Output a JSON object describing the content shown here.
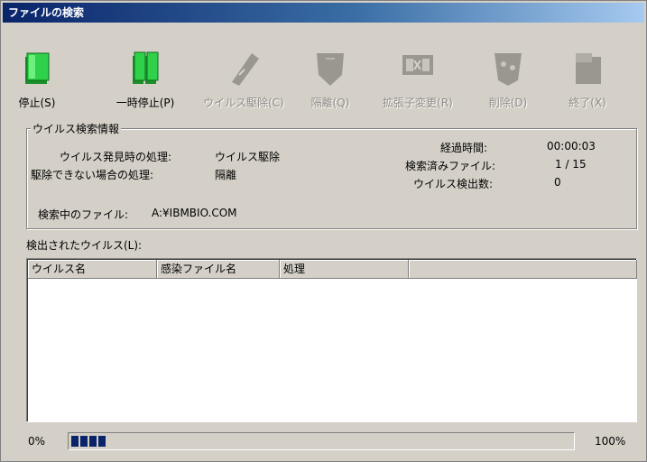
{
  "window": {
    "title": "ファイルの検索"
  },
  "toolbar": {
    "buttons": [
      {
        "label": "停止(S)",
        "icon": "stop-icon",
        "enabled": true
      },
      {
        "label": "一時停止(P)",
        "icon": "pause-icon",
        "enabled": true
      },
      {
        "label": "ウイルス駆除(C)",
        "icon": "clean-virus-icon",
        "enabled": false
      },
      {
        "label": "隔離(Q)",
        "icon": "quarantine-icon",
        "enabled": false
      },
      {
        "label": "拡張子変更(R)",
        "icon": "rename-extension-icon",
        "enabled": false
      },
      {
        "label": "削除(D)",
        "icon": "delete-icon",
        "enabled": false
      },
      {
        "label": "終了(X)",
        "icon": "exit-icon",
        "enabled": false
      }
    ]
  },
  "scan_info": {
    "legend": "ウイルス検索情報",
    "on_detect_label": "ウイルス発見時の処理:",
    "on_detect_value": "ウイルス駆除",
    "on_fail_label": "駆除できない場合の処理:",
    "on_fail_value": "隔離",
    "elapsed_label": "経過時間:",
    "elapsed_value": "00:00:03",
    "scanned_label": "検索済みファイル:",
    "scanned_value": "1 / 15",
    "detected_label": "ウイルス検出数:",
    "detected_value": "0",
    "current_file_label": "検索中のファイル:",
    "current_file_value": "A:¥IBMBIO.COM"
  },
  "detected_list": {
    "label": "検出されたウイルス(L):",
    "columns": [
      "ウイルス名",
      "感染ファイル名",
      "処理",
      ""
    ],
    "rows": []
  },
  "progress": {
    "min_label": "0%",
    "max_label": "100%",
    "value_percent": 7
  },
  "colors": {
    "title_gradient_start": "#0a246a",
    "progress_fill": "#0a246a",
    "enabled_icon": "#2ea02e"
  }
}
